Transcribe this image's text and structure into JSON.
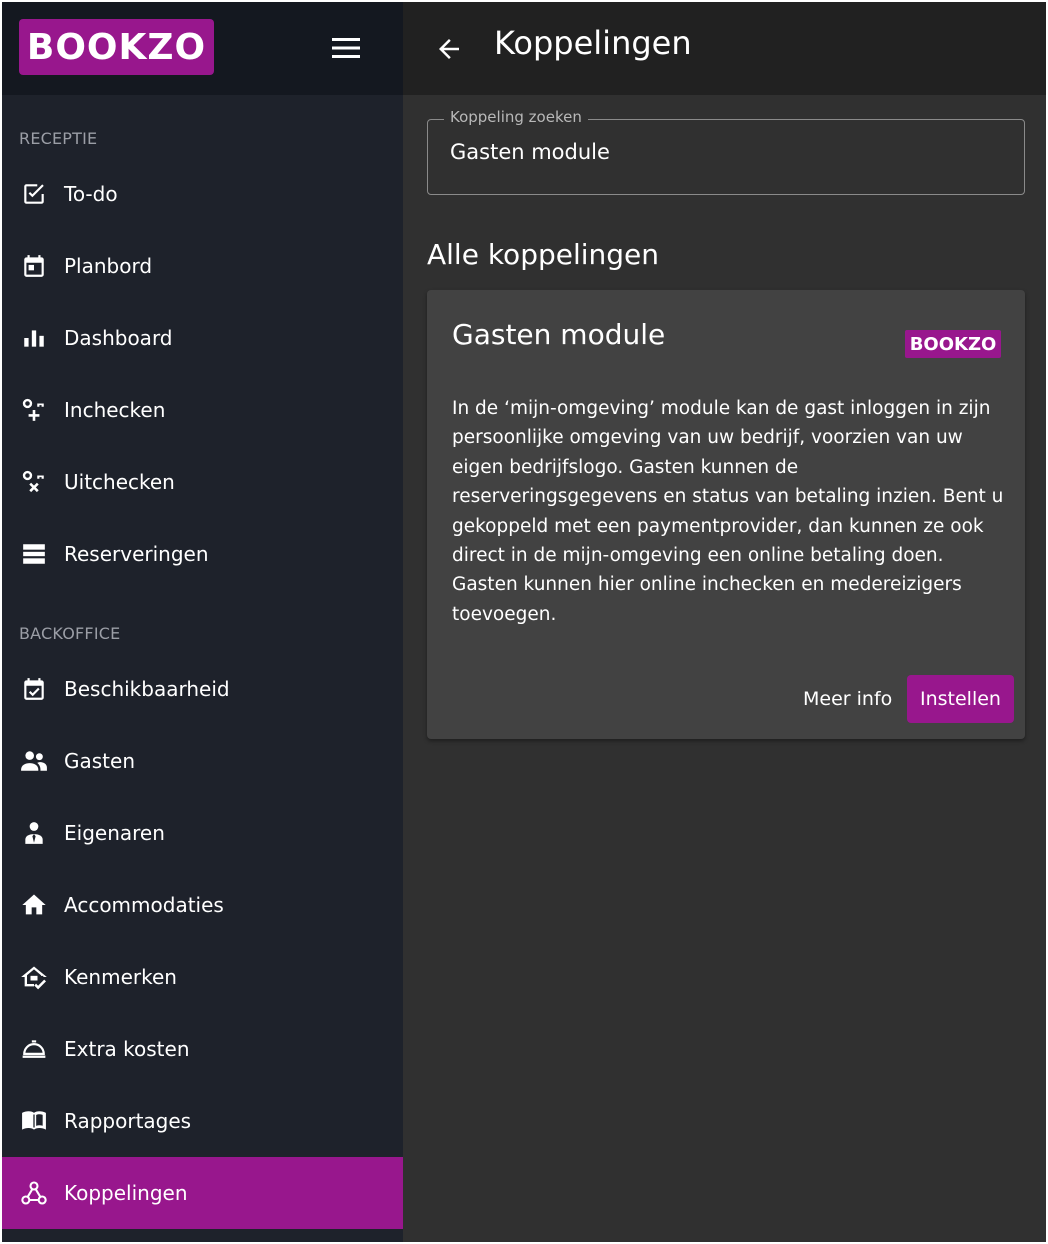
{
  "brand": {
    "logo_text": "BOOKZO",
    "accent": "#98178d"
  },
  "sidebar": {
    "sections": [
      {
        "label": "RECEPTIE",
        "items": [
          {
            "label": "To-do",
            "icon": "checkbox-icon"
          },
          {
            "label": "Planbord",
            "icon": "calendar-icon"
          },
          {
            "label": "Dashboard",
            "icon": "bar-chart-icon"
          },
          {
            "label": "Inchecken",
            "icon": "key-plus-icon"
          },
          {
            "label": "Uitchecken",
            "icon": "key-minus-icon"
          },
          {
            "label": "Reserveringen",
            "icon": "list-icon"
          }
        ]
      },
      {
        "label": "BACKOFFICE",
        "items": [
          {
            "label": "Beschikbaarheid",
            "icon": "calendar-check-icon"
          },
          {
            "label": "Gasten",
            "icon": "people-icon"
          },
          {
            "label": "Eigenaren",
            "icon": "person-tie-icon"
          },
          {
            "label": "Accommodaties",
            "icon": "home-icon"
          },
          {
            "label": "Kenmerken",
            "icon": "home-check-icon"
          },
          {
            "label": "Extra kosten",
            "icon": "room-service-icon"
          },
          {
            "label": "Rapportages",
            "icon": "book-icon"
          },
          {
            "label": "Koppelingen",
            "icon": "webhook-icon",
            "active": true
          }
        ]
      }
    ]
  },
  "header": {
    "title": "Koppelingen",
    "back_icon": "arrow-left-icon"
  },
  "search": {
    "label": "Koppeling zoeken",
    "value": "Gasten module"
  },
  "main": {
    "heading": "Alle koppelingen",
    "card": {
      "title": "Gasten module",
      "logo_text": "BOOKZO",
      "description": "In de ‘mijn-omgeving’ module kan de gast inloggen in zijn persoonlijke omgeving van uw bedrijf, voorzien van uw eigen bedrijfslogo. Gasten kunnen de reserveringsgegevens en status van betaling inzien. Bent u gekoppeld met een paymentprovider, dan kunnen ze ook direct in de mijn-omgeving een online betaling doen. Gasten kunnen hier online inchecken en medereizigers toevoegen.",
      "more_info_label": "Meer info",
      "setup_label": "Instellen"
    }
  }
}
